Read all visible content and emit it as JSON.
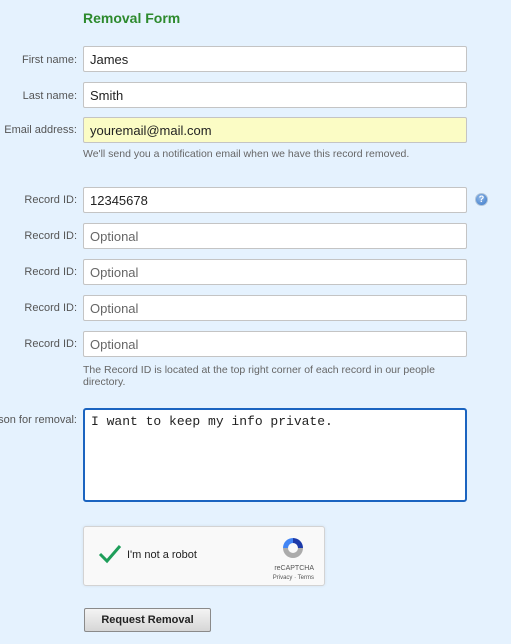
{
  "form": {
    "title": "Removal Form",
    "first_name": {
      "label": "First name:",
      "value": "James"
    },
    "last_name": {
      "label": "Last name:",
      "value": "Smith"
    },
    "email": {
      "label": "Email address:",
      "value": "youremail@mail.com",
      "hint": "We'll send you a notification email when we have this record removed."
    },
    "record_ids": [
      {
        "label": "Record ID:",
        "value": "12345678",
        "placeholder": ""
      },
      {
        "label": "Record ID:",
        "value": "",
        "placeholder": "Optional"
      },
      {
        "label": "Record ID:",
        "value": "",
        "placeholder": "Optional"
      },
      {
        "label": "Record ID:",
        "value": "",
        "placeholder": "Optional"
      },
      {
        "label": "Record ID:",
        "value": "",
        "placeholder": "Optional"
      }
    ],
    "record_hint": "The Record ID is located at the top right corner of each record in our people directory.",
    "help_icon": "question-mark-icon",
    "reason": {
      "label": "son for removal:",
      "value": "I want to keep my info private."
    },
    "captcha": {
      "label": "I'm not a robot",
      "brand": "reCAPTCHA",
      "links": "Privacy · Terms",
      "checked": true
    },
    "submit_label": "Request Removal"
  },
  "colors": {
    "title": "#2d8a2d",
    "background": "#e5f2fe",
    "email_highlight": "#fbfcc5",
    "focus_border": "#1b64c0",
    "check": "#1e9e5a"
  }
}
